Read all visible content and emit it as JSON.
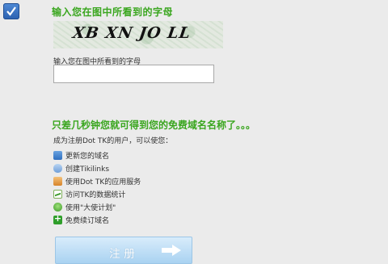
{
  "captcha": {
    "heading": "输入您在图中所看到的字母",
    "image_text": "XB XN JO LL",
    "field_label": "输入您在图中所看到的字母",
    "value": ""
  },
  "promo": {
    "heading": "只差几秒钟您就可得到您的免费域名名称了。。。",
    "intro": "成为注册Dot TK的用户，可以使您：",
    "benefits": [
      {
        "label": "更新您的域名",
        "icon": "domain-icon"
      },
      {
        "label": "创建Tikilinks",
        "icon": "link-icon"
      },
      {
        "label": "使用Dot TK的应用服务",
        "icon": "apps-icon"
      },
      {
        "label": "访问TK的数据统计",
        "icon": "stats-icon"
      },
      {
        "label": "使用\"大使计划\"",
        "icon": "ambassador-icon"
      },
      {
        "label": "免费续订域名",
        "icon": "renew-plus-icon"
      }
    ]
  },
  "register_button": {
    "label": "注册",
    "icon": "arrow-right-icon"
  },
  "colors": {
    "heading_green": "#3aa61f",
    "checkbox_blue": "#2b61b0",
    "button_blue": "#a9d2f1"
  }
}
